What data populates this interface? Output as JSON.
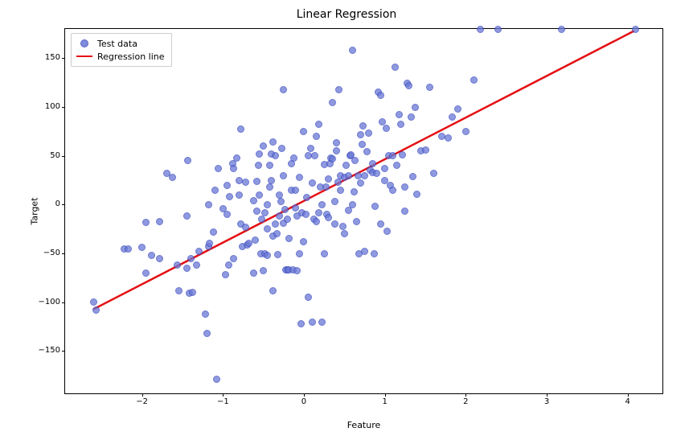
{
  "chart_data": {
    "type": "scatter",
    "title": "Linear Regression",
    "xlabel": "Feature",
    "ylabel": "Target",
    "xlim": [
      -2.95,
      4.45
    ],
    "ylim": [
      -195,
      180
    ],
    "xticks": [
      -2,
      -1,
      0,
      1,
      2,
      3,
      4
    ],
    "yticks": [
      -150,
      -100,
      -50,
      0,
      50,
      100,
      150
    ],
    "series": [
      {
        "name": "Test data",
        "role": "scatter",
        "x": [
          -2.6,
          -2.57,
          -2.22,
          -2.17,
          -2.0,
          -1.95,
          -1.95,
          -1.88,
          -1.78,
          -1.78,
          -1.69,
          -1.62,
          -1.56,
          -1.54,
          -1.45,
          -1.45,
          -1.44,
          -1.42,
          -1.4,
          -1.38,
          -1.33,
          -1.3,
          -1.22,
          -1.2,
          -1.18,
          -1.18,
          -1.17,
          -1.12,
          -1.1,
          -1.08,
          -1.06,
          -1.0,
          -0.97,
          -0.95,
          -0.95,
          -0.93,
          -0.92,
          -0.88,
          -0.87,
          -0.87,
          -0.83,
          -0.8,
          -0.8,
          -0.78,
          -0.78,
          -0.76,
          -0.72,
          -0.72,
          -0.7,
          -0.68,
          -0.62,
          -0.62,
          -0.6,
          -0.58,
          -0.58,
          -0.56,
          -0.55,
          -0.55,
          -0.53,
          -0.52,
          -0.5,
          -0.5,
          -0.48,
          -0.48,
          -0.45,
          -0.45,
          -0.45,
          -0.42,
          -0.42,
          -0.4,
          -0.4,
          -0.38,
          -0.38,
          -0.38,
          -0.35,
          -0.35,
          -0.33,
          -0.32,
          -0.3,
          -0.3,
          -0.28,
          -0.27,
          -0.25,
          -0.25,
          -0.25,
          -0.23,
          -0.22,
          -0.2,
          -0.2,
          -0.18,
          -0.18,
          -0.15,
          -0.15,
          -0.13,
          -0.12,
          -0.1,
          -0.1,
          -0.08,
          -0.08,
          -0.05,
          -0.05,
          -0.03,
          -0.02,
          0.0,
          0.0,
          0.02,
          0.03,
          0.05,
          0.05,
          0.08,
          0.1,
          0.1,
          0.12,
          0.13,
          0.15,
          0.15,
          0.18,
          0.18,
          0.2,
          0.22,
          0.22,
          0.25,
          0.25,
          0.27,
          0.28,
          0.3,
          0.3,
          0.32,
          0.33,
          0.35,
          0.35,
          0.38,
          0.38,
          0.4,
          0.4,
          0.42,
          0.43,
          0.45,
          0.45,
          0.48,
          0.5,
          0.5,
          0.52,
          0.55,
          0.55,
          0.57,
          0.58,
          0.6,
          0.6,
          0.62,
          0.63,
          0.65,
          0.67,
          0.68,
          0.7,
          0.7,
          0.72,
          0.73,
          0.75,
          0.75,
          0.78,
          0.8,
          0.82,
          0.85,
          0.85,
          0.87,
          0.88,
          0.9,
          0.92,
          0.95,
          0.95,
          0.97,
          1.0,
          1.0,
          1.02,
          1.03,
          1.05,
          1.07,
          1.1,
          1.1,
          1.13,
          1.15,
          1.18,
          1.2,
          1.22,
          1.25,
          1.25,
          1.28,
          1.3,
          1.33,
          1.35,
          1.38,
          1.4,
          1.45,
          1.5,
          1.55,
          1.6,
          1.7,
          1.78,
          1.83,
          1.9,
          2.0,
          2.1,
          2.18,
          2.4,
          3.18,
          4.1
        ],
        "y": [
          -100,
          -108,
          -45,
          -45,
          -44,
          -18,
          -70,
          -52,
          -55,
          -17,
          32,
          28,
          -62,
          -88,
          -65,
          -12,
          45,
          -91,
          -55,
          -90,
          -62,
          -48,
          -112,
          -132,
          -43,
          0,
          -40,
          -28,
          15,
          -179,
          37,
          -4,
          -72,
          -10,
          20,
          -62,
          8,
          42,
          37,
          -55,
          48,
          25,
          10,
          -20,
          77,
          -43,
          -23,
          23,
          -41,
          -40,
          -70,
          4,
          -36,
          -7,
          24,
          40,
          52,
          10,
          -50,
          -15,
          -68,
          60,
          -50,
          -8,
          0,
          -25,
          -52,
          40,
          18,
          25,
          52,
          64,
          -32,
          -88,
          -20,
          50,
          -30,
          -51,
          -12,
          10,
          3,
          58,
          118,
          30,
          -19,
          -5,
          -67,
          -67,
          -15,
          -35,
          -67,
          42,
          15,
          -67,
          48,
          15,
          -3,
          -68,
          -12,
          28,
          -50,
          -122,
          -8,
          -38,
          75,
          -10,
          7,
          50,
          -95,
          58,
          22,
          -120,
          -15,
          50,
          70,
          -17,
          -8,
          82,
          18,
          -120,
          0,
          -50,
          41,
          18,
          -10,
          -13,
          26,
          42,
          48,
          105,
          47,
          3,
          -20,
          55,
          63,
          23,
          118,
          15,
          30,
          -22,
          28,
          -30,
          40,
          30,
          -6,
          50,
          51,
          158,
          0,
          13,
          45,
          -17,
          30,
          -50,
          22,
          72,
          62,
          81,
          30,
          -48,
          54,
          73,
          35,
          42,
          33,
          -50,
          -2,
          32,
          115,
          112,
          -20,
          85,
          25,
          37,
          78,
          -27,
          50,
          20,
          15,
          50,
          141,
          40,
          92,
          82,
          51,
          18,
          -7,
          124,
          122,
          90,
          29,
          100,
          11,
          55,
          56,
          120,
          32,
          70,
          68,
          90,
          98,
          75,
          128
        ]
      },
      {
        "name": "Regression line",
        "role": "line",
        "color": "#e40f13",
        "x": [
          -2.6,
          4.1
        ],
        "y": [
          -108,
          178
        ]
      }
    ],
    "legend": {
      "position": "upper left",
      "entries": [
        "Test data",
        "Regression line"
      ]
    }
  }
}
